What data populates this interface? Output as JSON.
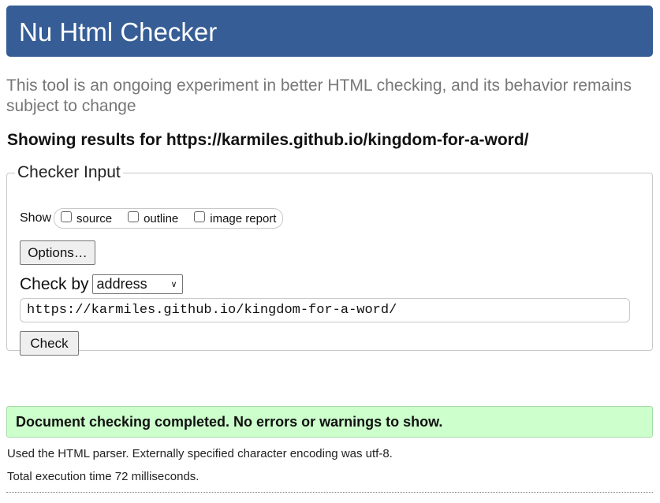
{
  "header": {
    "title": "Nu Html Checker"
  },
  "intro": "This tool is an ongoing experiment in better HTML checking, and its behavior remains subject to change",
  "results_for": "Showing results for https://karmiles.github.io/kingdom-for-a-word/",
  "checker_input": {
    "legend": "Checker Input",
    "show_label": "Show",
    "show_options": [
      {
        "label": "source",
        "checked": false
      },
      {
        "label": "outline",
        "checked": false
      },
      {
        "label": "image report",
        "checked": false
      }
    ],
    "options_button": "Options…",
    "check_by_label": "Check by",
    "check_by_value": "address",
    "url_value": "https://karmiles.github.io/kingdom-for-a-word/",
    "check_button": "Check"
  },
  "result": {
    "success_message": "Document checking completed. No errors or warnings to show.",
    "parser_note": "Used the HTML parser. Externally specified character encoding was utf-8.",
    "timing_note": "Total execution time 72 milliseconds."
  },
  "colors": {
    "header_bg": "#365d95",
    "success_bg": "#ccffcc"
  }
}
